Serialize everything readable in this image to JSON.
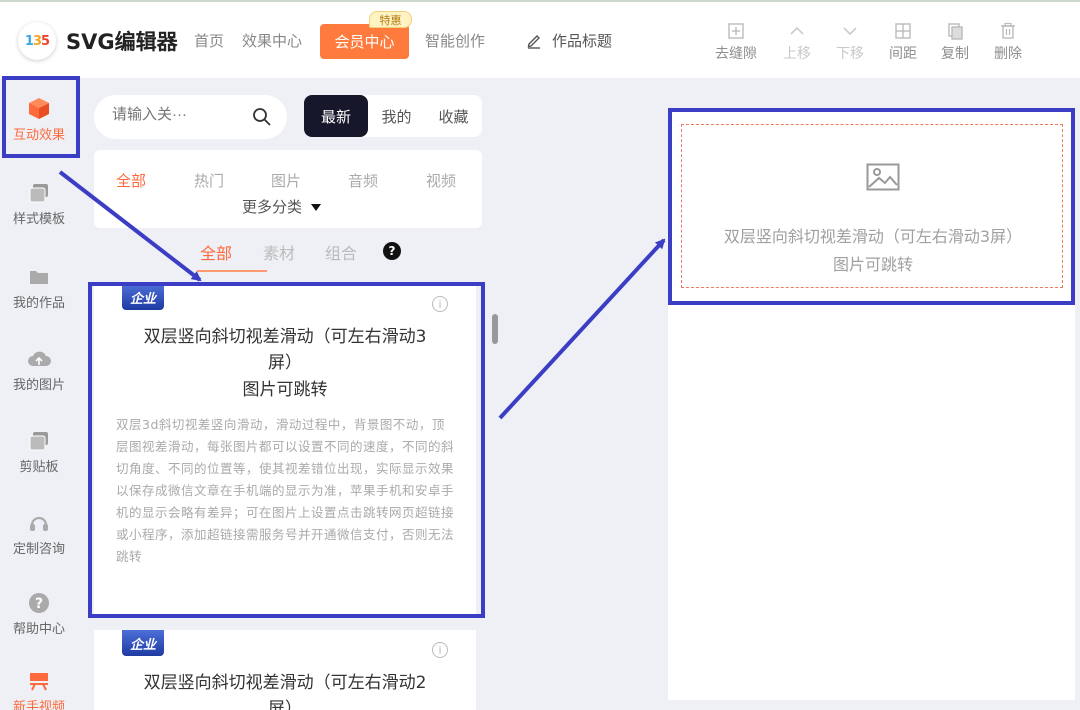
{
  "app": {
    "logo_text_1": "1",
    "logo_text_2": "3",
    "logo_text_3": "5",
    "name": "SVG编辑器"
  },
  "nav": {
    "home": "首页",
    "effects": "效果中心",
    "vip": "会员中心",
    "vip_badge": "特惠",
    "smart": "智能创作",
    "work_title": "作品标题"
  },
  "toolbar": {
    "gap": "去缝隙",
    "up": "上移",
    "down": "下移",
    "spacing": "间距",
    "copy": "复制",
    "delete": "删除"
  },
  "sidebar": {
    "items": [
      {
        "label": "互动效果",
        "icon": "cube-icon"
      },
      {
        "label": "样式模板",
        "icon": "template-icon"
      },
      {
        "label": "我的作品",
        "icon": "folder-icon"
      },
      {
        "label": "我的图片",
        "icon": "cloud-upload-icon"
      },
      {
        "label": "剪贴板",
        "icon": "clipboard-icon"
      },
      {
        "label": "定制咨询",
        "icon": "headset-icon"
      },
      {
        "label": "帮助中心",
        "icon": "help-icon"
      },
      {
        "label": "新手视频",
        "icon": "video-icon"
      }
    ]
  },
  "panel": {
    "search_placeholder": "请输入关···",
    "seg": [
      "最新",
      "我的",
      "收藏"
    ],
    "cats": [
      "全部",
      "热门",
      "图片",
      "音频",
      "视频"
    ],
    "more_cats": "更多分类",
    "subtabs": [
      "全部",
      "素材",
      "组合"
    ],
    "help_mark": "?"
  },
  "cards": [
    {
      "badge": "企业",
      "info": "i",
      "title_line1": "双层竖向斜切视差滑动（可左右滑动3",
      "title_line2": "屏）",
      "title_line3": "图片可跳转",
      "desc": "双层3d斜切视差竖向滑动，滑动过程中，背景图不动，顶层图视差滑动，每张图片都可以设置不同的速度，不同的斜切角度、不同的位置等，使其视差错位出现，实际显示效果以保存成微信文章在手机端的显示为准，苹果手机和安卓手机的显示会略有差异；可在图片上设置点击跳转网页超链接或小程序，添加超链接需服务号并开通微信支付，否则无法跳转"
    },
    {
      "badge": "企业",
      "info": "i",
      "title_line1": "双层竖向斜切视差滑动（可左右滑动2",
      "title_line2": "屏）"
    }
  ],
  "canvas": {
    "placeholder_line1": "双层竖向斜切视差滑动（可左右滑动3屏）",
    "placeholder_line2": "图片可跳转"
  },
  "colors": {
    "accent": "#ff6a3d",
    "highlight": "#3b3ec5",
    "dark_seg": "#17172b"
  }
}
